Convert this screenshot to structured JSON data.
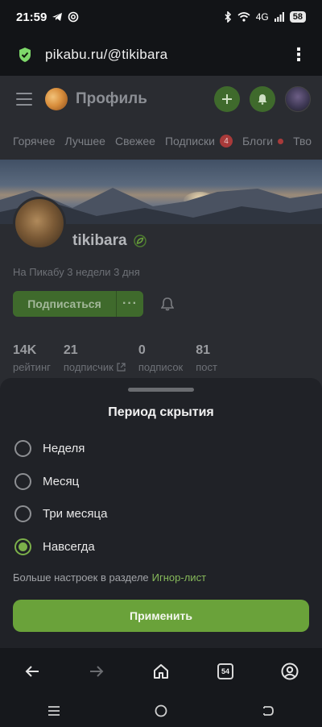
{
  "status_bar": {
    "time": "21:59",
    "network": "4G",
    "battery": "58"
  },
  "browser": {
    "url": "pikabu.ru/@tikibara"
  },
  "header": {
    "title": "Профиль"
  },
  "nav_tabs": [
    {
      "label": "Горячее"
    },
    {
      "label": "Лучшее"
    },
    {
      "label": "Свежее"
    },
    {
      "label": "Подписки",
      "badge": "4"
    },
    {
      "label": "Блоги"
    },
    {
      "label": "Тво"
    }
  ],
  "profile": {
    "username": "tikibara",
    "joined": "На Пикабу 3 недели 3 дня",
    "subscribe_label": "Подписаться",
    "more_label": "···",
    "stats": [
      {
        "value": "14K",
        "label": "рейтинг"
      },
      {
        "value": "21",
        "label": "подписчик"
      },
      {
        "value": "0",
        "label": "подписок"
      },
      {
        "value": "81",
        "label": "пост"
      }
    ]
  },
  "sheet": {
    "title": "Период скрытия",
    "options": [
      {
        "label": "Неделя",
        "checked": false
      },
      {
        "label": "Месяц",
        "checked": false
      },
      {
        "label": "Три месяца",
        "checked": false
      },
      {
        "label": "Навсегда",
        "checked": true
      }
    ],
    "more_settings_text": "Больше настроек в разделе",
    "ignore_link": "Игнор-лист",
    "apply_label": "Применить"
  },
  "toolbar": {
    "tabs_count": "54"
  },
  "colors": {
    "accent": "#6aa23a",
    "link": "#86b95a",
    "badge": "#a83a3a"
  }
}
